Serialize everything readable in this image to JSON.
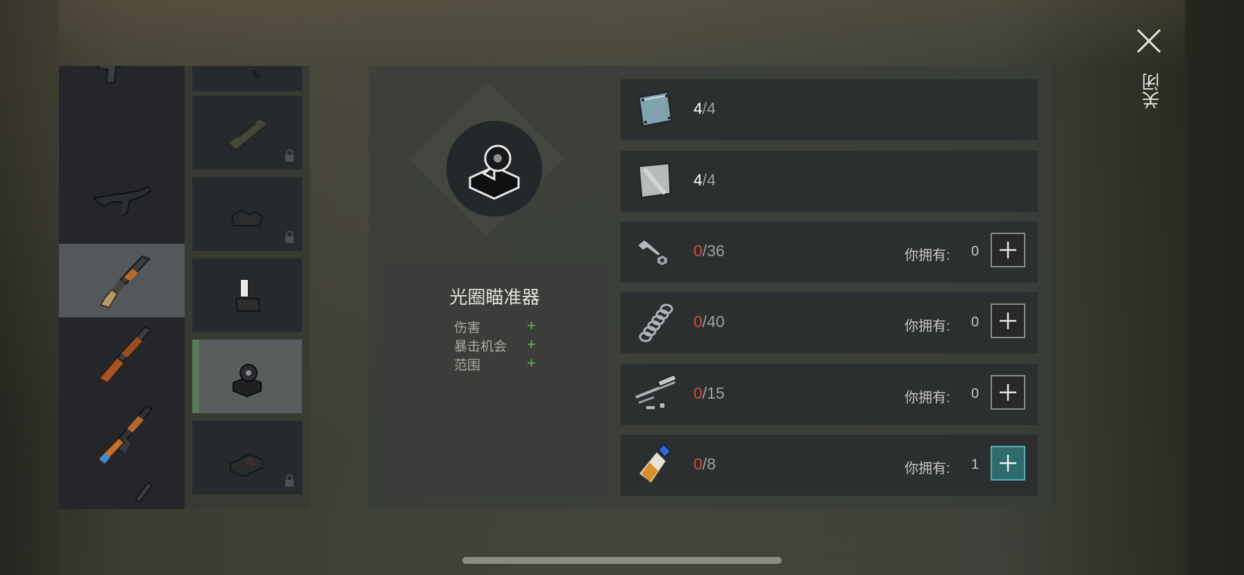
{
  "close": {
    "label": "关闭"
  },
  "weapons": [
    {
      "name": "pistol-icon"
    },
    {
      "name": "smg-icon"
    },
    {
      "name": "shotgun-icon",
      "selected": true
    },
    {
      "name": "lever-rifle-icon"
    },
    {
      "name": "assault-rifle-icon"
    },
    {
      "name": "sniper-rifle-icon"
    }
  ],
  "attachments": [
    {
      "name": "handguard-icon",
      "locked": true
    },
    {
      "name": "grip-icon",
      "locked": true
    },
    {
      "name": "laser-sight-icon",
      "locked": false
    },
    {
      "name": "aperture-sight-icon",
      "locked": false,
      "selected": true
    },
    {
      "name": "red-dot-sight-icon",
      "locked": true
    }
  ],
  "item": {
    "title": "光圈瞄准器",
    "stats": [
      {
        "label": "伤害",
        "sign": "+"
      },
      {
        "label": "暴击机会",
        "sign": "+"
      },
      {
        "label": "范围",
        "sign": "+"
      }
    ]
  },
  "requirements": [
    {
      "icon": "metal-plate-icon",
      "current": "4",
      "required": "4",
      "sufficient": true
    },
    {
      "icon": "steel-sheet-icon",
      "current": "4",
      "required": "4",
      "sufficient": true
    },
    {
      "icon": "bolts-nuts-icon",
      "current": "0",
      "required": "36",
      "sufficient": false,
      "have_label": "你拥有:",
      "have": "0"
    },
    {
      "icon": "spring-icon",
      "current": "0",
      "required": "40",
      "sufficient": false,
      "have_label": "你拥有:",
      "have": "0"
    },
    {
      "icon": "weapon-parts-icon",
      "current": "0",
      "required": "15",
      "sufficient": false,
      "have_label": "你拥有:",
      "have": "0"
    },
    {
      "icon": "glue-icon",
      "current": "0",
      "required": "8",
      "sufficient": false,
      "have_label": "你拥有:",
      "have": "1",
      "highlight": true
    }
  ],
  "colors": {
    "ok": "#ffffff",
    "insufficient": "#d24b3f",
    "stat_plus": "#5fbf4a",
    "active_button": "#2f6b6d"
  }
}
